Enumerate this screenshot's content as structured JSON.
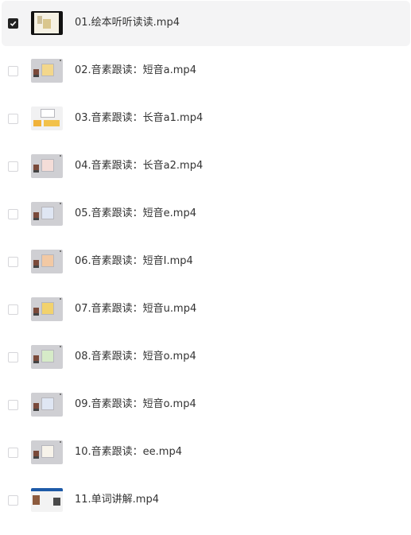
{
  "files": [
    {
      "name": "01.绘本听听读读.mp4",
      "checked": true,
      "thumb_icon": "video-thumbnail-icon"
    },
    {
      "name": "02.音素跟读：短音a.mp4",
      "checked": false,
      "thumb_icon": "video-thumbnail-icon"
    },
    {
      "name": "03.音素跟读：长音a1.mp4",
      "checked": false,
      "thumb_icon": "video-thumbnail-icon"
    },
    {
      "name": "04.音素跟读：长音a2.mp4",
      "checked": false,
      "thumb_icon": "video-thumbnail-icon"
    },
    {
      "name": "05.音素跟读：短音e.mp4",
      "checked": false,
      "thumb_icon": "video-thumbnail-icon"
    },
    {
      "name": "06.音素跟读：短音I.mp4",
      "checked": false,
      "thumb_icon": "video-thumbnail-icon"
    },
    {
      "name": "07.音素跟读：短音u.mp4",
      "checked": false,
      "thumb_icon": "video-thumbnail-icon"
    },
    {
      "name": "08.音素跟读：短音o.mp4",
      "checked": false,
      "thumb_icon": "video-thumbnail-icon"
    },
    {
      "name": "09.音素跟读：短音o.mp4",
      "checked": false,
      "thumb_icon": "video-thumbnail-icon"
    },
    {
      "name": "10.音素跟读：ee.mp4",
      "checked": false,
      "thumb_icon": "video-thumbnail-icon"
    },
    {
      "name": "11.单词讲解.mp4",
      "checked": false,
      "thumb_icon": "video-thumbnail-icon"
    }
  ],
  "colors": {
    "selected_row_bg": "#f4f4f5",
    "checkbox_checked": "#222222",
    "text": "#333333"
  }
}
